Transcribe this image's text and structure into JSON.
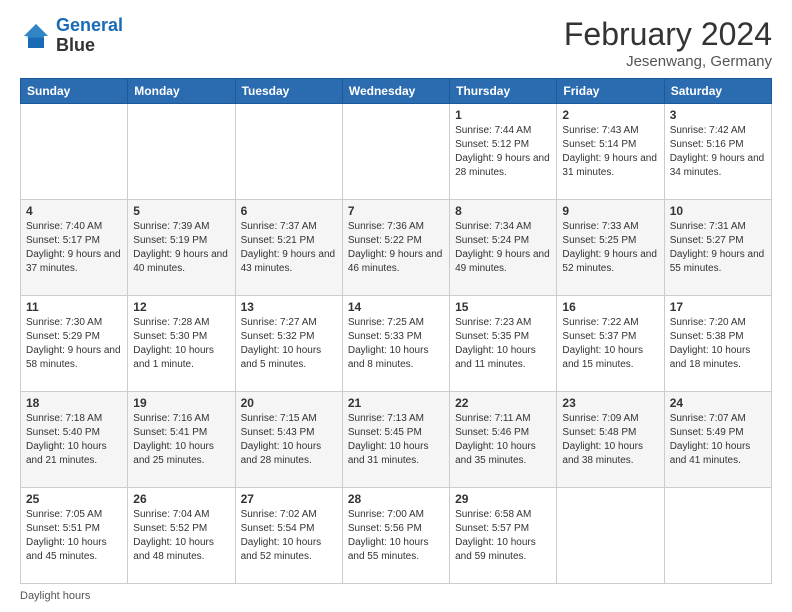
{
  "header": {
    "logo_line1": "General",
    "logo_line2": "Blue",
    "month_year": "February 2024",
    "location": "Jesenwang, Germany"
  },
  "weekdays": [
    "Sunday",
    "Monday",
    "Tuesday",
    "Wednesday",
    "Thursday",
    "Friday",
    "Saturday"
  ],
  "weeks": [
    [
      {
        "day": "",
        "sunrise": "",
        "sunset": "",
        "daylight": ""
      },
      {
        "day": "",
        "sunrise": "",
        "sunset": "",
        "daylight": ""
      },
      {
        "day": "",
        "sunrise": "",
        "sunset": "",
        "daylight": ""
      },
      {
        "day": "",
        "sunrise": "",
        "sunset": "",
        "daylight": ""
      },
      {
        "day": "1",
        "sunrise": "Sunrise: 7:44 AM",
        "sunset": "Sunset: 5:12 PM",
        "daylight": "Daylight: 9 hours and 28 minutes."
      },
      {
        "day": "2",
        "sunrise": "Sunrise: 7:43 AM",
        "sunset": "Sunset: 5:14 PM",
        "daylight": "Daylight: 9 hours and 31 minutes."
      },
      {
        "day": "3",
        "sunrise": "Sunrise: 7:42 AM",
        "sunset": "Sunset: 5:16 PM",
        "daylight": "Daylight: 9 hours and 34 minutes."
      }
    ],
    [
      {
        "day": "4",
        "sunrise": "Sunrise: 7:40 AM",
        "sunset": "Sunset: 5:17 PM",
        "daylight": "Daylight: 9 hours and 37 minutes."
      },
      {
        "day": "5",
        "sunrise": "Sunrise: 7:39 AM",
        "sunset": "Sunset: 5:19 PM",
        "daylight": "Daylight: 9 hours and 40 minutes."
      },
      {
        "day": "6",
        "sunrise": "Sunrise: 7:37 AM",
        "sunset": "Sunset: 5:21 PM",
        "daylight": "Daylight: 9 hours and 43 minutes."
      },
      {
        "day": "7",
        "sunrise": "Sunrise: 7:36 AM",
        "sunset": "Sunset: 5:22 PM",
        "daylight": "Daylight: 9 hours and 46 minutes."
      },
      {
        "day": "8",
        "sunrise": "Sunrise: 7:34 AM",
        "sunset": "Sunset: 5:24 PM",
        "daylight": "Daylight: 9 hours and 49 minutes."
      },
      {
        "day": "9",
        "sunrise": "Sunrise: 7:33 AM",
        "sunset": "Sunset: 5:25 PM",
        "daylight": "Daylight: 9 hours and 52 minutes."
      },
      {
        "day": "10",
        "sunrise": "Sunrise: 7:31 AM",
        "sunset": "Sunset: 5:27 PM",
        "daylight": "Daylight: 9 hours and 55 minutes."
      }
    ],
    [
      {
        "day": "11",
        "sunrise": "Sunrise: 7:30 AM",
        "sunset": "Sunset: 5:29 PM",
        "daylight": "Daylight: 9 hours and 58 minutes."
      },
      {
        "day": "12",
        "sunrise": "Sunrise: 7:28 AM",
        "sunset": "Sunset: 5:30 PM",
        "daylight": "Daylight: 10 hours and 1 minute."
      },
      {
        "day": "13",
        "sunrise": "Sunrise: 7:27 AM",
        "sunset": "Sunset: 5:32 PM",
        "daylight": "Daylight: 10 hours and 5 minutes."
      },
      {
        "day": "14",
        "sunrise": "Sunrise: 7:25 AM",
        "sunset": "Sunset: 5:33 PM",
        "daylight": "Daylight: 10 hours and 8 minutes."
      },
      {
        "day": "15",
        "sunrise": "Sunrise: 7:23 AM",
        "sunset": "Sunset: 5:35 PM",
        "daylight": "Daylight: 10 hours and 11 minutes."
      },
      {
        "day": "16",
        "sunrise": "Sunrise: 7:22 AM",
        "sunset": "Sunset: 5:37 PM",
        "daylight": "Daylight: 10 hours and 15 minutes."
      },
      {
        "day": "17",
        "sunrise": "Sunrise: 7:20 AM",
        "sunset": "Sunset: 5:38 PM",
        "daylight": "Daylight: 10 hours and 18 minutes."
      }
    ],
    [
      {
        "day": "18",
        "sunrise": "Sunrise: 7:18 AM",
        "sunset": "Sunset: 5:40 PM",
        "daylight": "Daylight: 10 hours and 21 minutes."
      },
      {
        "day": "19",
        "sunrise": "Sunrise: 7:16 AM",
        "sunset": "Sunset: 5:41 PM",
        "daylight": "Daylight: 10 hours and 25 minutes."
      },
      {
        "day": "20",
        "sunrise": "Sunrise: 7:15 AM",
        "sunset": "Sunset: 5:43 PM",
        "daylight": "Daylight: 10 hours and 28 minutes."
      },
      {
        "day": "21",
        "sunrise": "Sunrise: 7:13 AM",
        "sunset": "Sunset: 5:45 PM",
        "daylight": "Daylight: 10 hours and 31 minutes."
      },
      {
        "day": "22",
        "sunrise": "Sunrise: 7:11 AM",
        "sunset": "Sunset: 5:46 PM",
        "daylight": "Daylight: 10 hours and 35 minutes."
      },
      {
        "day": "23",
        "sunrise": "Sunrise: 7:09 AM",
        "sunset": "Sunset: 5:48 PM",
        "daylight": "Daylight: 10 hours and 38 minutes."
      },
      {
        "day": "24",
        "sunrise": "Sunrise: 7:07 AM",
        "sunset": "Sunset: 5:49 PM",
        "daylight": "Daylight: 10 hours and 41 minutes."
      }
    ],
    [
      {
        "day": "25",
        "sunrise": "Sunrise: 7:05 AM",
        "sunset": "Sunset: 5:51 PM",
        "daylight": "Daylight: 10 hours and 45 minutes."
      },
      {
        "day": "26",
        "sunrise": "Sunrise: 7:04 AM",
        "sunset": "Sunset: 5:52 PM",
        "daylight": "Daylight: 10 hours and 48 minutes."
      },
      {
        "day": "27",
        "sunrise": "Sunrise: 7:02 AM",
        "sunset": "Sunset: 5:54 PM",
        "daylight": "Daylight: 10 hours and 52 minutes."
      },
      {
        "day": "28",
        "sunrise": "Sunrise: 7:00 AM",
        "sunset": "Sunset: 5:56 PM",
        "daylight": "Daylight: 10 hours and 55 minutes."
      },
      {
        "day": "29",
        "sunrise": "Sunrise: 6:58 AM",
        "sunset": "Sunset: 5:57 PM",
        "daylight": "Daylight: 10 hours and 59 minutes."
      },
      {
        "day": "",
        "sunrise": "",
        "sunset": "",
        "daylight": ""
      },
      {
        "day": "",
        "sunrise": "",
        "sunset": "",
        "daylight": ""
      }
    ]
  ],
  "footer": {
    "daylight_label": "Daylight hours"
  }
}
